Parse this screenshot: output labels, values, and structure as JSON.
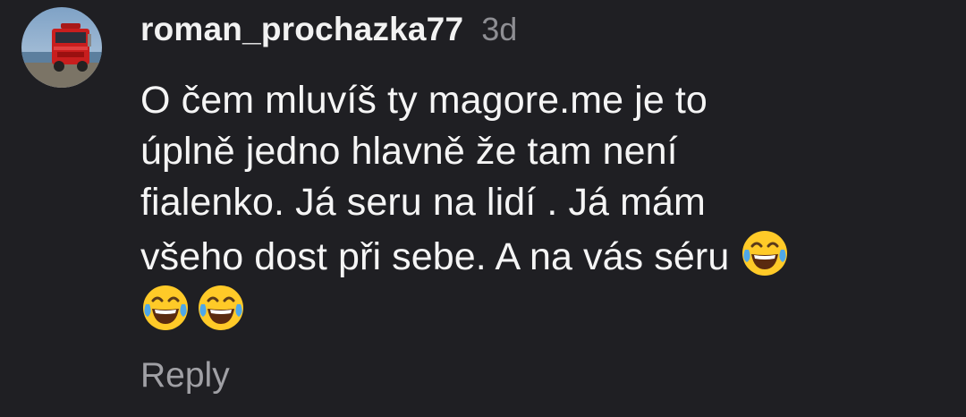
{
  "comment": {
    "username": "roman_prochazka77",
    "timestamp": "3d",
    "body_lines": [
      "O čem mluvíš ty magore.me je to",
      "úplně jedno hlavně že tam není",
      "fialenko. Já seru na lidí . Já mám",
      "všeho dost při sebe. A na vás séru"
    ],
    "emoji": {
      "inline_after_line_4": "face-with-tears-of-joy-emoji",
      "trailing_row": [
        "face-with-tears-of-joy-emoji",
        "face-with-tears-of-joy-emoji"
      ]
    },
    "reply_label": "Reply"
  },
  "avatar": {
    "icon": "avatar-red-truck-photo"
  },
  "colors": {
    "background": "#1f1f23",
    "username": "#f2f2f2",
    "body_text": "#f5f5f5",
    "muted": "#8e8e93"
  }
}
